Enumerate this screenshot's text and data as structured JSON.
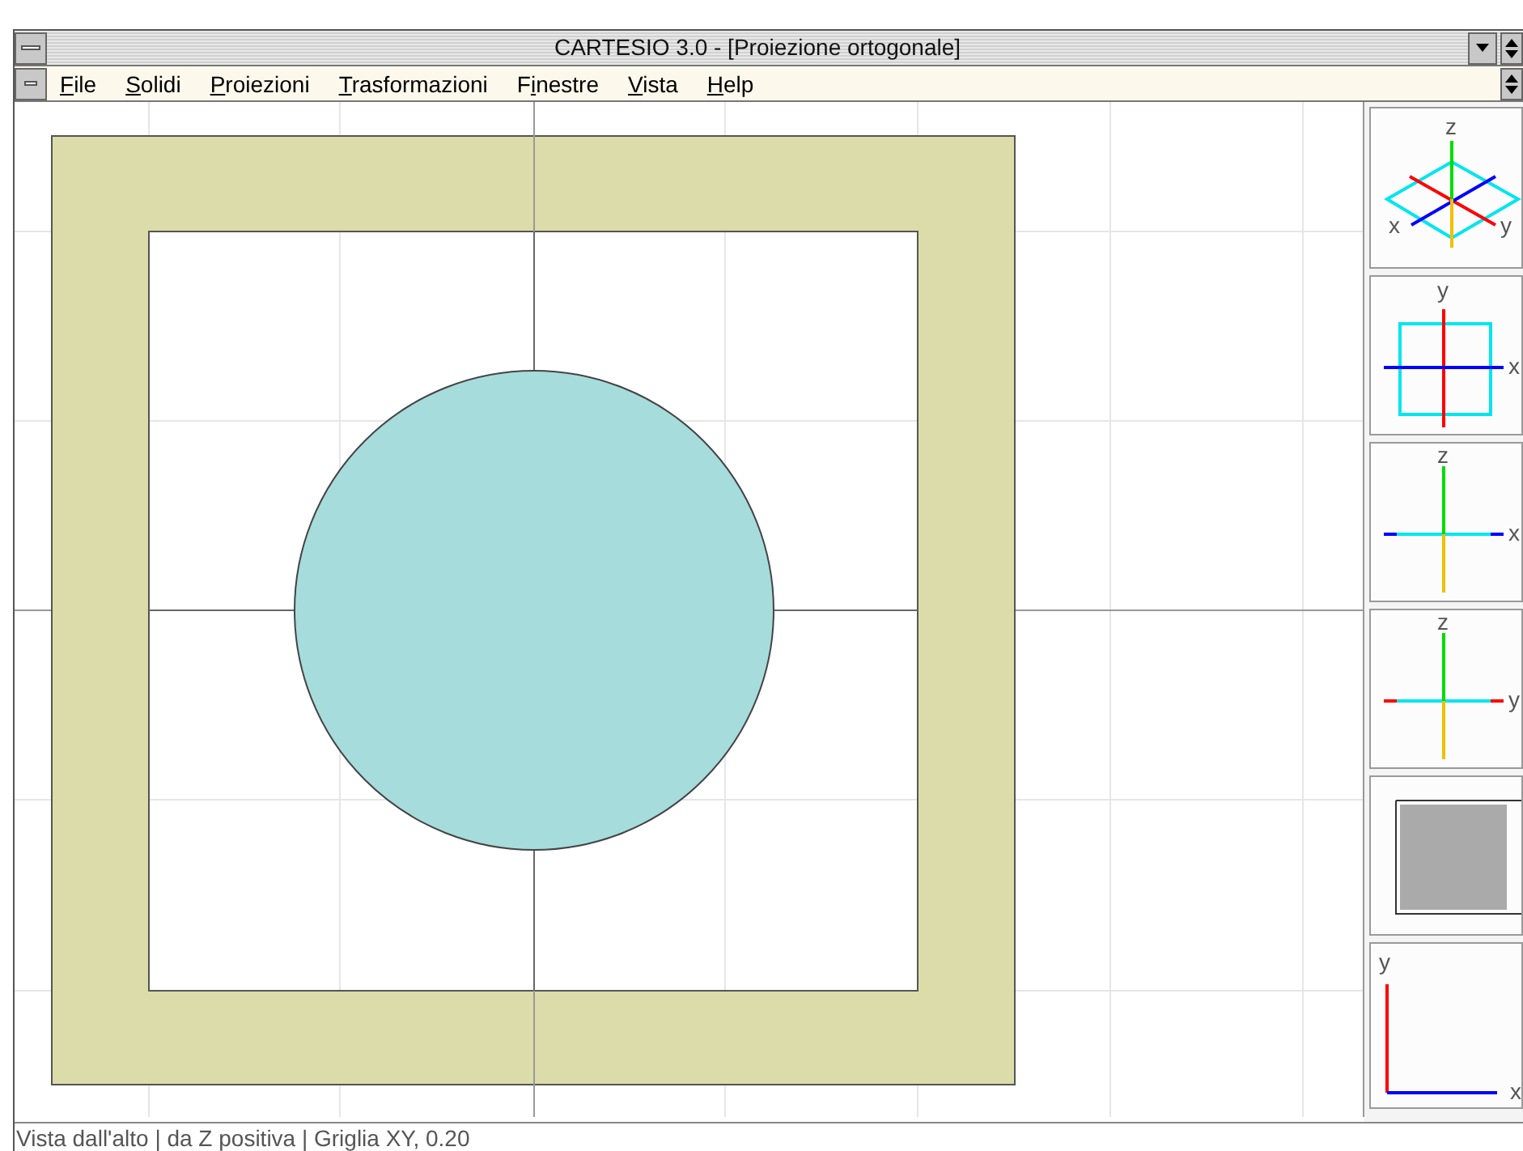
{
  "window": {
    "title": "CARTESIO 3.0 - [Proiezione ortogonale]"
  },
  "menu": [
    {
      "key": "F",
      "after": "ile"
    },
    {
      "key": "S",
      "after": "olidi"
    },
    {
      "key": "P",
      "after": "roiezioni"
    },
    {
      "key": "T",
      "after": "rasformazioni"
    },
    {
      "before": "F",
      "key": "i",
      "after": "nestre"
    },
    {
      "key": "V",
      "after": "ista"
    },
    {
      "key": "H",
      "after": "elp"
    }
  ],
  "view_panels": [
    {
      "kind": "iso",
      "labels": [
        "z",
        "x",
        "y"
      ]
    },
    {
      "kind": "top",
      "labels": [
        "y",
        "x"
      ]
    },
    {
      "kind": "front",
      "labels": [
        "z",
        "x"
      ]
    },
    {
      "kind": "side",
      "labels": [
        "z",
        "y"
      ]
    },
    {
      "kind": "color"
    },
    {
      "kind": "axes",
      "labels": [
        "y",
        "x"
      ]
    }
  ],
  "status_bar": "Vista dall'alto | da Z positiva | Griglia XY, 0.20"
}
